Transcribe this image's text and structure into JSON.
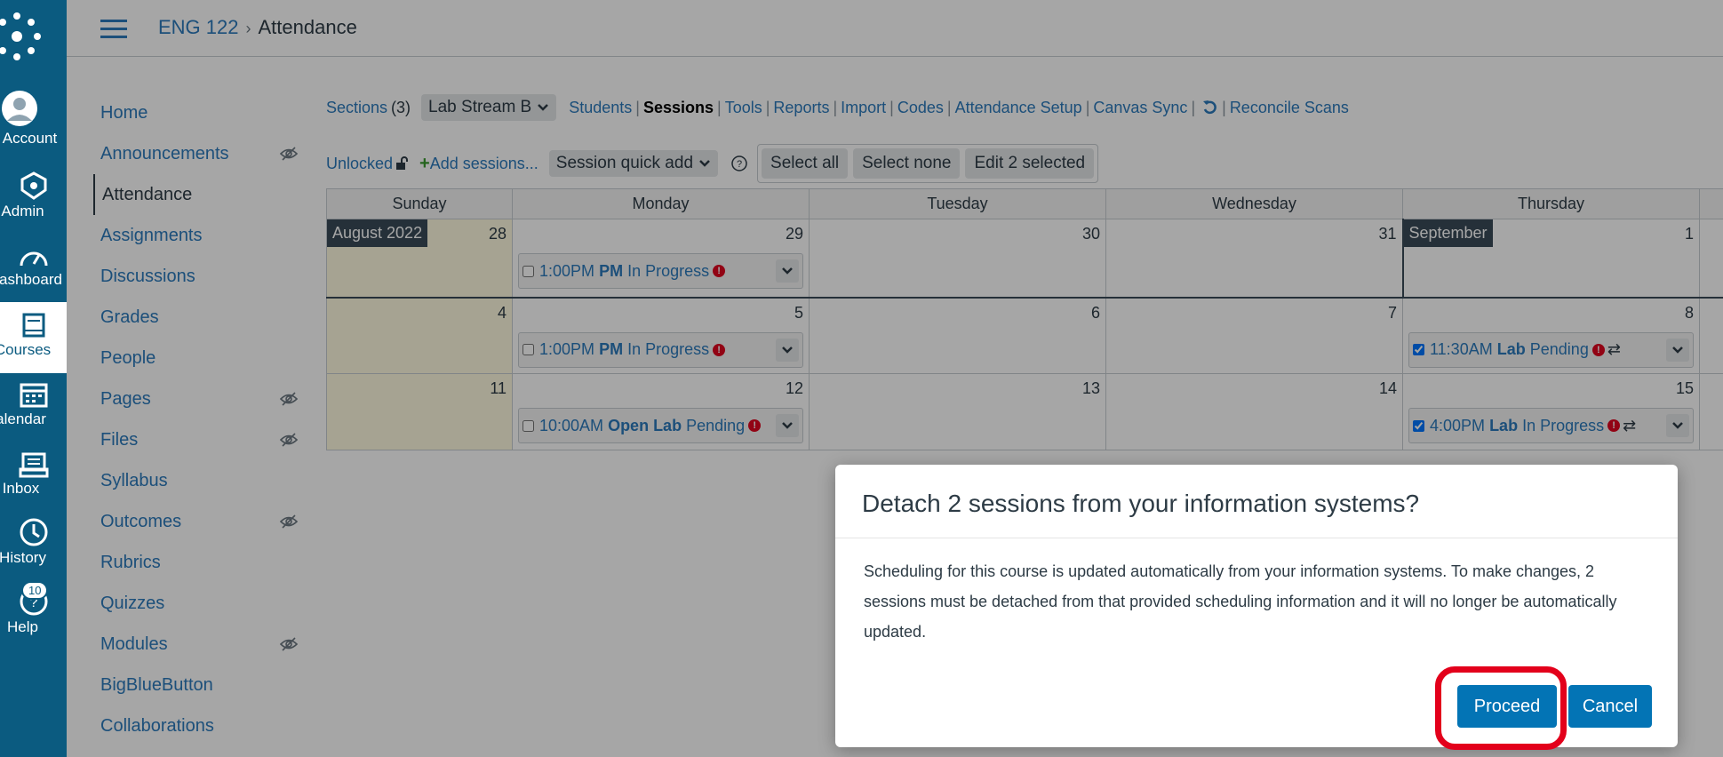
{
  "global_nav": {
    "items": [
      {
        "label": "Account",
        "icon": "account-icon"
      },
      {
        "label": "Admin",
        "icon": "admin-icon"
      },
      {
        "label": "ashboard",
        "icon": "dashboard-icon"
      },
      {
        "label": "Courses",
        "icon": "courses-icon"
      },
      {
        "label": "alendar",
        "icon": "calendar-icon"
      },
      {
        "label": "Inbox",
        "icon": "inbox-icon"
      },
      {
        "label": "History",
        "icon": "history-icon"
      },
      {
        "label": "Help",
        "icon": "help-icon",
        "badge": "10"
      }
    ]
  },
  "breadcrumb": {
    "course": "ENG 122",
    "page": "Attendance"
  },
  "course_nav": {
    "items": [
      {
        "label": "Home"
      },
      {
        "label": "Announcements",
        "hidden": true
      },
      {
        "label": "Attendance",
        "active": true
      },
      {
        "label": "Assignments"
      },
      {
        "label": "Discussions"
      },
      {
        "label": "Grades"
      },
      {
        "label": "People"
      },
      {
        "label": "Pages",
        "hidden": true
      },
      {
        "label": "Files",
        "hidden": true
      },
      {
        "label": "Syllabus"
      },
      {
        "label": "Outcomes",
        "hidden": true
      },
      {
        "label": "Rubrics"
      },
      {
        "label": "Quizzes"
      },
      {
        "label": "Modules",
        "hidden": true
      },
      {
        "label": "BigBlueButton"
      },
      {
        "label": "Collaborations"
      }
    ]
  },
  "toolbar": {
    "sections_label": "Sections",
    "sections_count": "(3)",
    "section_select": "Lab Stream B",
    "links": [
      "Students",
      "Sessions",
      "Tools",
      "Reports",
      "Import",
      "Codes",
      "Attendance Setup",
      "Canvas Sync"
    ],
    "reconcile": "Reconcile Scans",
    "unlocked": "Unlocked",
    "add_sessions": "Add sessions...",
    "quick_add": "Session quick add",
    "select_all": "Select all",
    "select_none": "Select none",
    "edit_selected": "Edit 2 selected"
  },
  "calendar": {
    "days": [
      "Sunday",
      "Monday",
      "Tuesday",
      "Wednesday",
      "Thursday"
    ],
    "month_labels": {
      "aug": "August 2022",
      "sep": "September"
    },
    "dates": {
      "r1": [
        "28",
        "29",
        "30",
        "31",
        "1"
      ],
      "r2": [
        "4",
        "5",
        "6",
        "7",
        "8"
      ],
      "r3": [
        "11",
        "12",
        "13",
        "14",
        "15"
      ]
    },
    "sessions": {
      "r1_mon": {
        "time": "1:00PM",
        "name": "PM",
        "status": "In Progress",
        "checked": false
      },
      "r2_mon": {
        "time": "1:00PM",
        "name": "PM",
        "status": "In Progress",
        "checked": false
      },
      "r2_thu": {
        "time": "11:30AM",
        "name": "Lab",
        "status": "Pending",
        "checked": true
      },
      "r3_mon": {
        "time": "10:00AM",
        "name": "Open Lab",
        "status": "Pending",
        "checked": false
      },
      "r3_thu": {
        "time": "4:00PM",
        "name": "Lab",
        "status": "In Progress",
        "checked": true
      }
    }
  },
  "modal": {
    "title": "Detach 2 sessions from your information systems?",
    "body": "Scheduling for this course is updated automatically from your information systems. To make changes, 2 sessions must be detached from that provided scheduling information and it will no longer be automatically updated.",
    "proceed": "Proceed",
    "cancel": "Cancel"
  },
  "colors": {
    "brand": "#0b5b80",
    "link": "#2b7abc",
    "button": "#0374b5",
    "highlight": "#e3001b",
    "error": "#e0061f"
  }
}
